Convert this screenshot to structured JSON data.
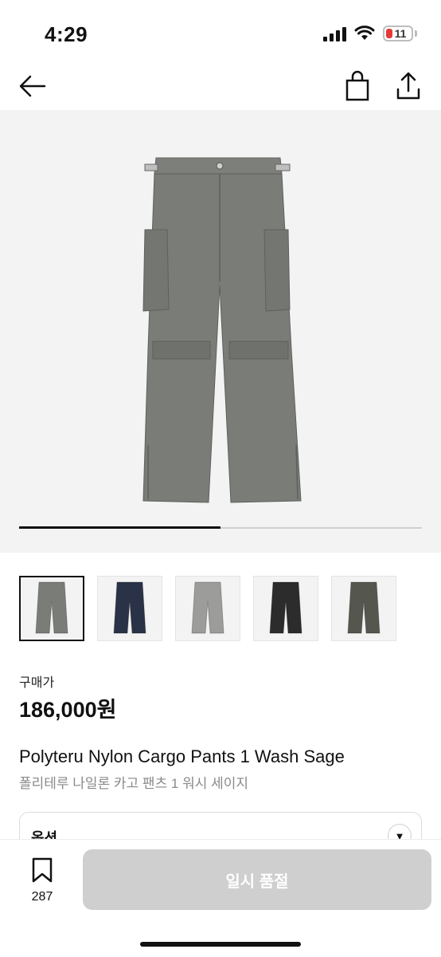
{
  "status_bar": {
    "time": "4:29",
    "battery_level": "11"
  },
  "product": {
    "price_label": "구매가",
    "price": "186,000원",
    "title_en": "Polyteru Nylon Cargo Pants 1 Wash Sage",
    "title_ko": "폴리테루 나일론 카고 팬츠 1 워시 세이지"
  },
  "gallery": {
    "progress": 0.5,
    "thumbnails": [
      {
        "color": "#7a7c78",
        "selected": true
      },
      {
        "color": "#2a3247",
        "selected": false
      },
      {
        "color": "#9c9c9a",
        "selected": false
      },
      {
        "color": "#2c2c2c",
        "selected": false
      },
      {
        "color": "#55564e",
        "selected": false
      }
    ]
  },
  "options": {
    "label": "옵션"
  },
  "bottom_bar": {
    "wish_count": "287",
    "buy_label": "일시 품절"
  },
  "colors": {
    "pants_main": "#7a7c78",
    "pants_shadow": "#6a6c68",
    "buy_disabled": "#cfcfcf"
  }
}
